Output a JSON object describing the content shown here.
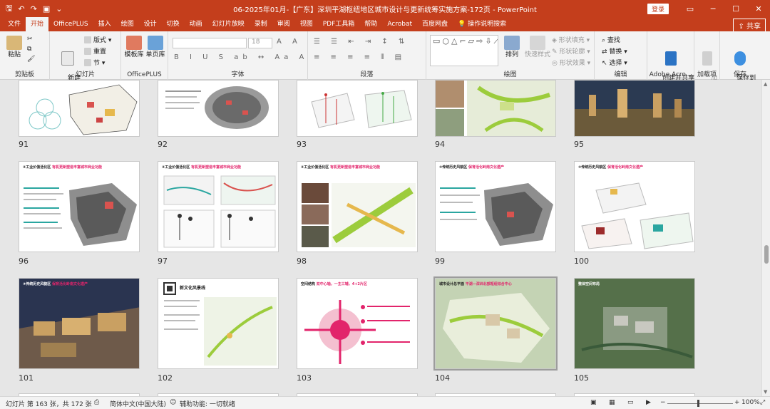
{
  "app": {
    "title": "06-2025年01月-【广东】深圳平湖枢纽地区城市设计与更新统筹实施方案-172页  -  PowerPoint",
    "login_label": "登录"
  },
  "colors": {
    "accent": "#c43e1c",
    "highlight": "#e2246b"
  },
  "tabs": [
    "文件",
    "开始",
    "OfficePLUS",
    "插入",
    "绘图",
    "设计",
    "切换",
    "动画",
    "幻灯片放映",
    "录制",
    "审阅",
    "视图",
    "PDF工具箱",
    "帮助",
    "Acrobat",
    "百度网盘"
  ],
  "tell_me": "操作说明搜索",
  "share_label": "共享",
  "ribbon": {
    "clipboard": {
      "paste": "粘贴",
      "label": "剪贴板"
    },
    "slides": {
      "new_slide": "新建\n幻灯片",
      "layout": "版式",
      "reset": "重置",
      "section": "节",
      "label": "幻灯片"
    },
    "officeplus": {
      "template": "模板库",
      "single": "单页库",
      "label": "OfficePLUS"
    },
    "font": {
      "size": "18",
      "label": "字体"
    },
    "paragraph": {
      "label": "段落"
    },
    "drawing": {
      "arrange": "排列",
      "quick_styles": "快速样式",
      "fill": "形状填充",
      "outline": "形状轮廓",
      "effects": "形状效果",
      "label": "绘图"
    },
    "editing": {
      "find": "查找",
      "replace": "替换",
      "select": "选择",
      "label": "编辑"
    },
    "adobe": {
      "create": "创建并共享\nAdobe PDF",
      "label": "Adobe Acro..."
    },
    "addins": {
      "button": "加\n载项",
      "label": "加载项"
    },
    "save": {
      "button": "保存到\n百度网盘",
      "label": "保存"
    }
  },
  "slides": [
    {
      "num": "91",
      "title": ""
    },
    {
      "num": "92",
      "title": ""
    },
    {
      "num": "93",
      "title": ""
    },
    {
      "num": "94",
      "title": ""
    },
    {
      "num": "95",
      "title": ""
    },
    {
      "num": "96",
      "title": "②工业价值活化区",
      "subtitle": "有机更新塑造丰富城市商业功能"
    },
    {
      "num": "97",
      "title": "②工业价值活化区",
      "subtitle": "有机更新塑造丰富城市商业功能"
    },
    {
      "num": "98",
      "title": "②工业价值活化区",
      "subtitle": "有机更新塑造丰富城市商业功能"
    },
    {
      "num": "99",
      "title": "③传统历史风貌区",
      "subtitle": "保育活化岭南文化遗产"
    },
    {
      "num": "100",
      "title": "③传统历史风貌区",
      "subtitle": "保育活化岭南文化遗产"
    },
    {
      "num": "101",
      "title": "③传统历史风貌区",
      "subtitle": "保育活化岭南文化遗产"
    },
    {
      "num": "102",
      "title": "新文化风景线",
      "subtitle": ""
    },
    {
      "num": "103",
      "title": "空间结构",
      "subtitle": "双中心轴，一主三辅，4+2片区"
    },
    {
      "num": "104",
      "title": "城市设计总平面",
      "subtitle": "平湖—深圳北部枢纽综合中心"
    },
    {
      "num": "105",
      "title": "整体空间布局",
      "subtitle": ""
    }
  ],
  "status": {
    "slide_info": "幻灯片 第 163 张，共 172 张",
    "language": "简体中文(中国大陆)",
    "accessibility": "辅助功能: 一切就绪",
    "zoom": "100%"
  }
}
